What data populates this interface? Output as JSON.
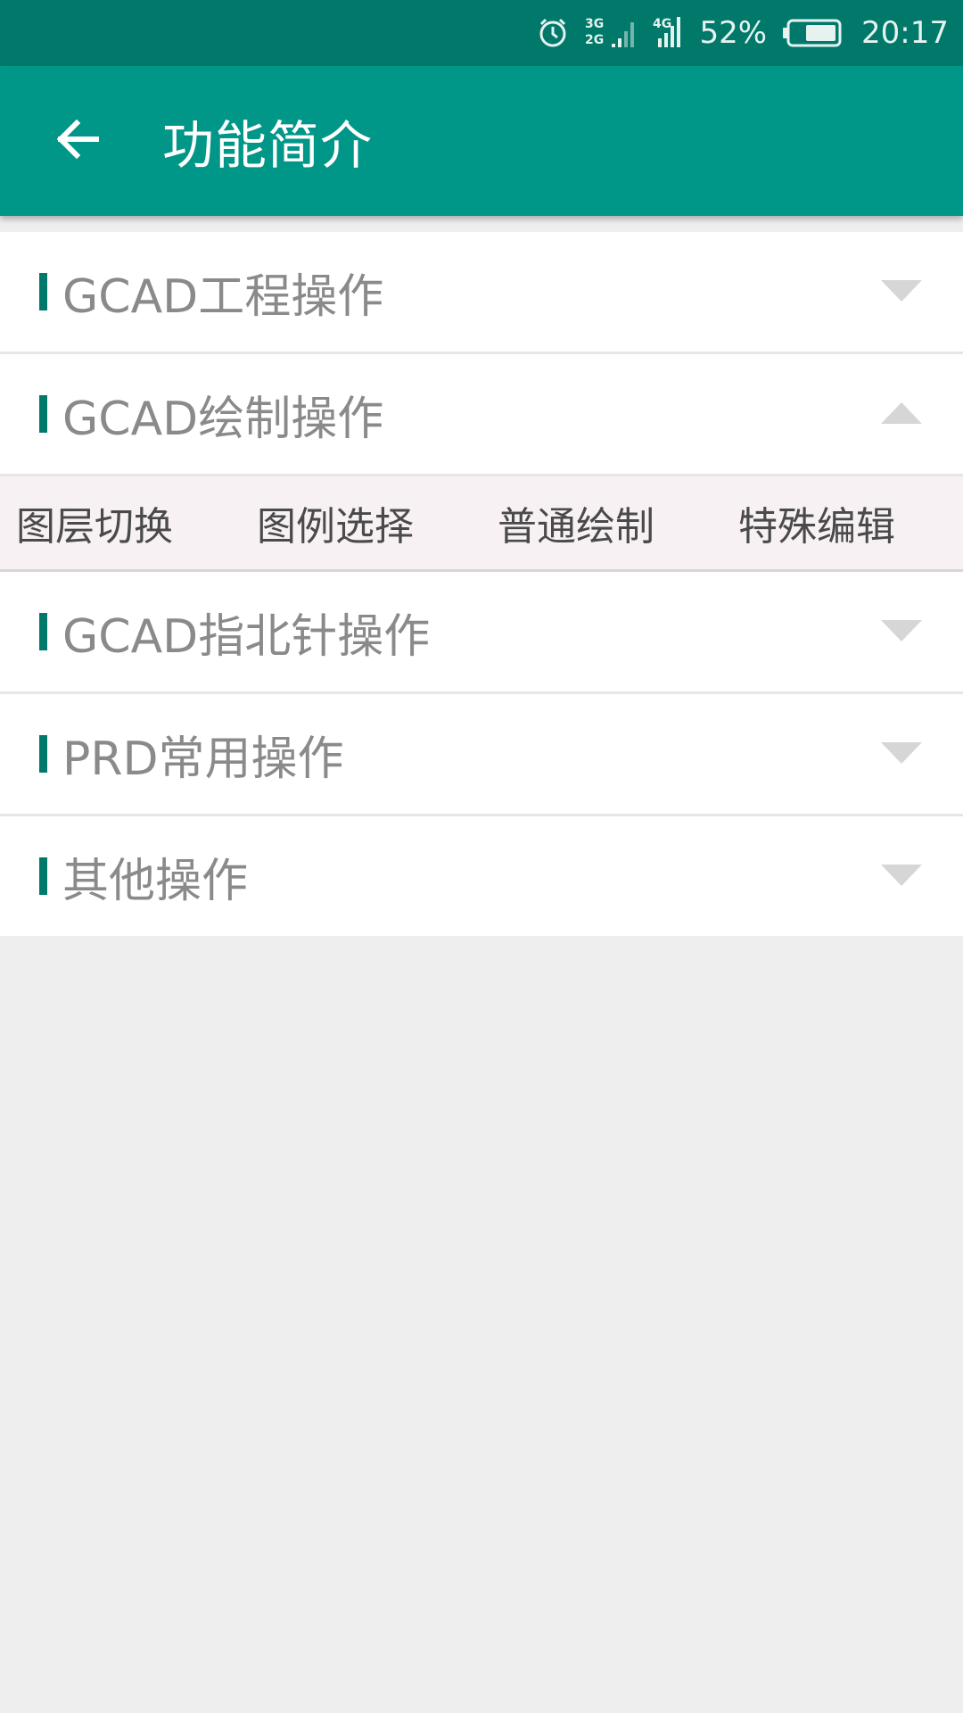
{
  "status_bar": {
    "icons": [
      "alarm-icon",
      "signal-3g-2g-icon",
      "signal-4g-icon",
      "battery-icon"
    ],
    "network_3g": "3G",
    "network_2g": "2G",
    "network_4g": "4G",
    "battery_percent": "52%",
    "time": "20:17"
  },
  "app_bar": {
    "title": "功能简介",
    "back_icon": "arrow-left-icon",
    "color": "#009688"
  },
  "sections": [
    {
      "label": "GCAD工程操作",
      "expanded": false
    },
    {
      "label": "GCAD绘制操作",
      "expanded": true,
      "sub_items": [
        "图层切换",
        "图例选择",
        "普通绘制",
        "特殊编辑"
      ]
    },
    {
      "label": "GCAD指北针操作",
      "expanded": false
    },
    {
      "label": "PRD常用操作",
      "expanded": false
    },
    {
      "label": "其他操作",
      "expanded": false
    }
  ],
  "colors": {
    "status_bar": "#00796b",
    "accent_bar": "#00796b",
    "background": "#eeeeee"
  }
}
